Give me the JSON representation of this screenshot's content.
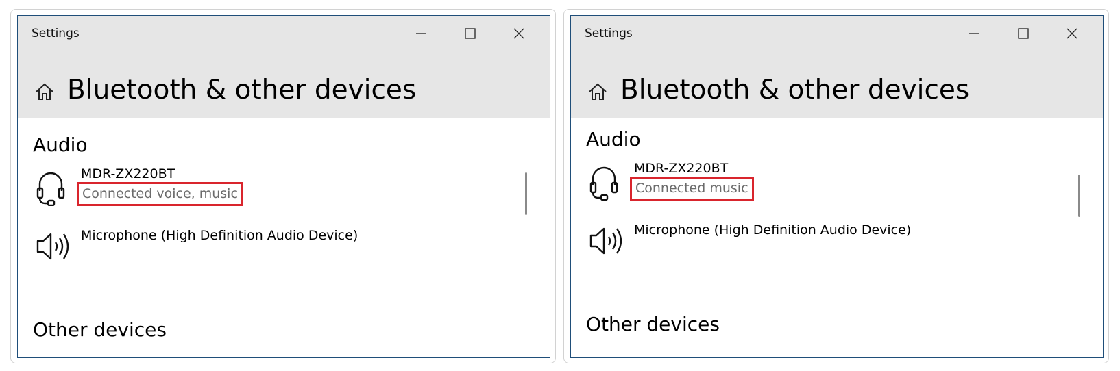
{
  "windows": [
    {
      "title": "Settings",
      "page_title": "Bluetooth & other devices",
      "audio_heading": "Audio",
      "devices": [
        {
          "name": "MDR-ZX220BT",
          "status": "Connected voice, music",
          "icon": "headset-icon"
        },
        {
          "name": "Microphone (High Definition Audio Device)",
          "status": "",
          "icon": "speaker-icon"
        }
      ],
      "other_heading": "Other devices"
    },
    {
      "title": "Settings",
      "page_title": "Bluetooth & other devices",
      "audio_heading": "Audio",
      "devices": [
        {
          "name": "MDR-ZX220BT",
          "status": "Connected music",
          "icon": "headset-icon"
        },
        {
          "name": "Microphone (High Definition Audio Device)",
          "status": "",
          "icon": "speaker-icon"
        }
      ],
      "other_heading": "Other devices"
    }
  ],
  "colors": {
    "highlight_border": "#d9252d",
    "titlebar_bg": "#e6e6e6",
    "window_border": "#1f4e79",
    "status_text": "#6b6b6b"
  }
}
